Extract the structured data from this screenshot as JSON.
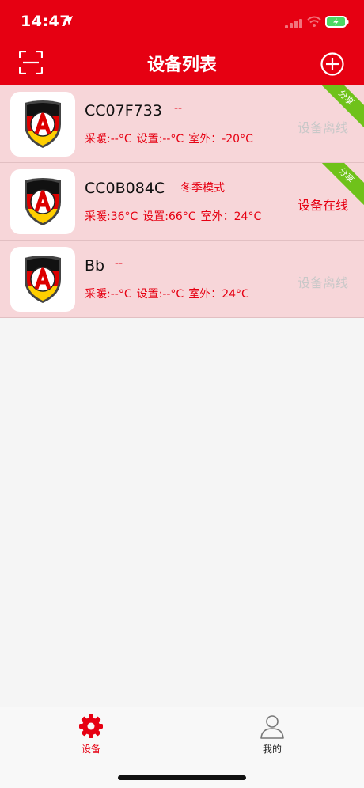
{
  "status_bar": {
    "time": "14:47"
  },
  "header": {
    "title": "设备列表"
  },
  "devices": [
    {
      "name": "CC07F733",
      "mode": "--",
      "heating": "采暖:--°C",
      "setting": "设置:--°C",
      "outdoor": "室外：-20°C",
      "status": "设备离线",
      "shared_tag": "分享"
    },
    {
      "name": "CC0B084C",
      "mode": "冬季模式",
      "heating": "采暖:36°C",
      "setting": "设置:66°C",
      "outdoor": "室外：24°C",
      "status": "设备在线",
      "shared_tag": "分享"
    },
    {
      "name": "Bb",
      "mode": "--",
      "heating": "采暖:--°C",
      "setting": "设置:--°C",
      "outdoor": "室外：24°C",
      "status": "设备离线"
    }
  ],
  "tabbar": {
    "devices_label": "设备",
    "mine_label": "我的"
  },
  "colors": {
    "brand_red": "#e60012",
    "row_bg": "#f7d6d9",
    "share_green": "#6fc21a",
    "offline_gray": "#c8c8c8"
  },
  "icons": {
    "scan": "scan-icon",
    "add": "plus-circle-icon",
    "device": "shield-logo-icon",
    "devices_tab": "gear-icon",
    "mine_tab": "person-icon"
  }
}
